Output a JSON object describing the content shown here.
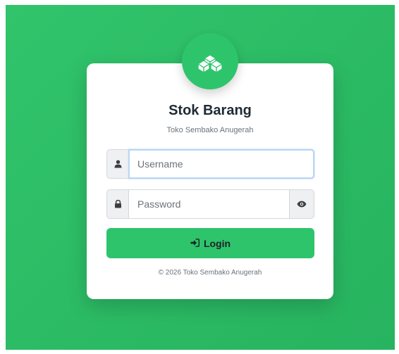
{
  "header": {
    "title": "Stok Barang",
    "subtitle": "Toko Sembako Anugerah"
  },
  "form": {
    "username_placeholder": "Username",
    "password_placeholder": "Password",
    "login_label": "Login"
  },
  "footer": {
    "text": "© 2026 Toko Sembako Anugerah"
  },
  "icons": {
    "logo": "boxes-icon",
    "username_prefix": "user-icon",
    "password_prefix": "lock-icon",
    "password_toggle": "eye-icon",
    "login": "sign-in-icon"
  },
  "colors": {
    "brand": "#2ec46b",
    "background": "#2bbb65",
    "focus_ring": "#bcd7f5"
  }
}
